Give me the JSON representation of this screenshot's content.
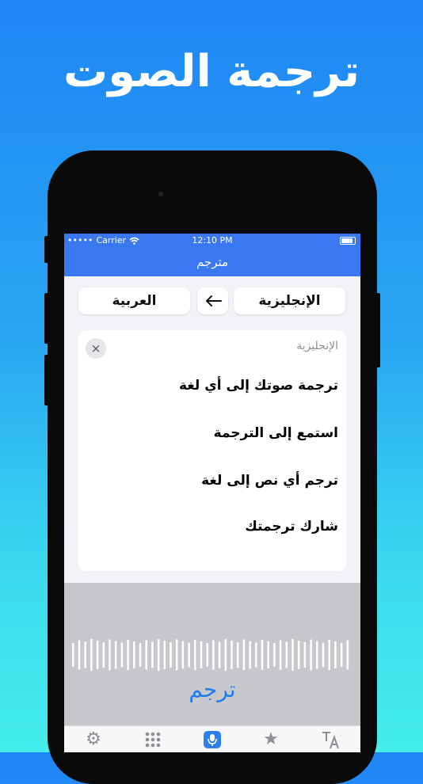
{
  "headline": "ترجمة الصوت",
  "status": {
    "carrier": "Carrier",
    "time": "12:10 PM"
  },
  "nav": {
    "title": "مترجم"
  },
  "languages": {
    "source": "الإنجليزية",
    "target": "العربية",
    "swap_icon": "arrow-left"
  },
  "card": {
    "source_label": "الإنجليزية",
    "close_icon": "×",
    "lines": [
      "ترجمة صوتك إلى أي لغة",
      "استمع إلى الترجمة",
      "ترجم أي نص إلى لغة",
      "شارك ترجمتك"
    ]
  },
  "voice": {
    "button_label": "ترجم"
  },
  "tabs": [
    {
      "name": "settings",
      "icon": "gear-icon"
    },
    {
      "name": "keypad",
      "icon": "grid-icon"
    },
    {
      "name": "voice",
      "icon": "microphone-icon",
      "active": true
    },
    {
      "name": "favorites",
      "icon": "star-icon"
    },
    {
      "name": "text",
      "icon": "text-translate-icon"
    }
  ],
  "colors": {
    "accent": "#3a78f2",
    "translate": "#1f7cf0"
  }
}
